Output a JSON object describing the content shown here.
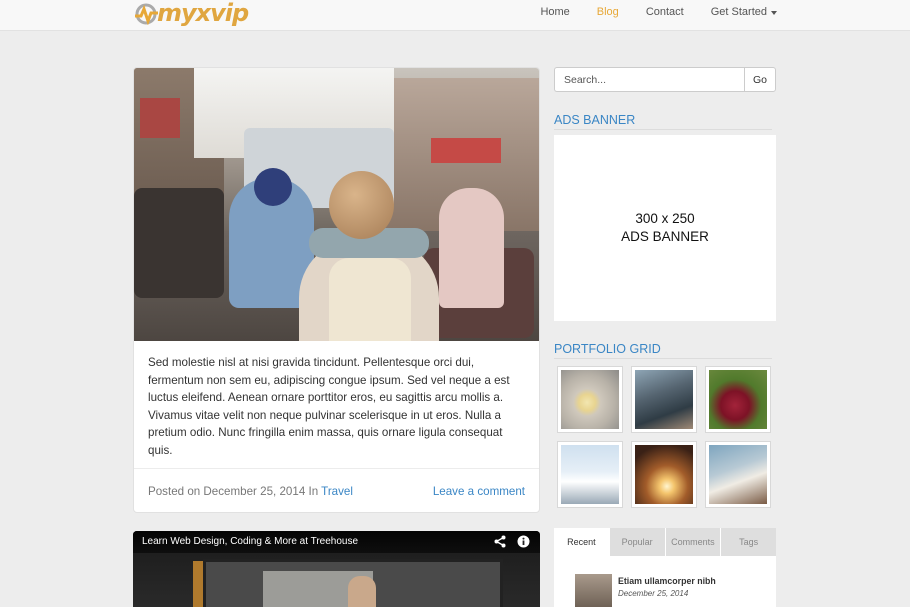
{
  "brand": {
    "logo_text": "myxvip",
    "accent": "#e7a837"
  },
  "nav": {
    "items": [
      {
        "label": "Home",
        "active": false
      },
      {
        "label": "Blog",
        "active": true
      },
      {
        "label": "Contact",
        "active": false
      },
      {
        "label": "Get Started",
        "active": false,
        "dropdown": true
      }
    ]
  },
  "post1": {
    "image": "street-scooter-photo",
    "excerpt": "Sed molestie nisl at nisi gravida tincidunt. Pellentesque orci dui, fermentum non sem eu, adipiscing congue ipsum. Sed vel neque a est luctus eleifend. Aenean ornare porttitor eros, eu sagittis arcu mollis a. Vivamus vitae velit non neque pulvinar scelerisque in ut eros. Nulla a pretium odio. Nunc fringilla enim massa, quis ornare ligula consequat quis.",
    "posted_prefix": "Posted on December 25, 2014 In",
    "category": "Travel",
    "comment_link": "Leave a comment"
  },
  "post2": {
    "video_title": "Learn Web Design, Coding & More at Treehouse",
    "icons": [
      "share-icon",
      "info-icon"
    ]
  },
  "sidebar": {
    "search": {
      "placeholder": "Search...",
      "button": "Go"
    },
    "ads": {
      "title": "ADS BANNER",
      "line1": "300 x 250",
      "line2": "ADS BANNER"
    },
    "portfolio": {
      "title": "PORTFOLIO GRID",
      "items": [
        "coffee-cup-thumb",
        "skater-thumb",
        "onion-thumb",
        "seagull-thumb",
        "sunset-street-thumb",
        "cups-thumb"
      ]
    },
    "tabs": {
      "labels": [
        "Recent",
        "Popular",
        "Comments",
        "Tags"
      ],
      "active": "Recent",
      "recent": [
        {
          "title": "Etiam ullamcorper nibh",
          "date": "December 25, 2014"
        }
      ]
    }
  }
}
